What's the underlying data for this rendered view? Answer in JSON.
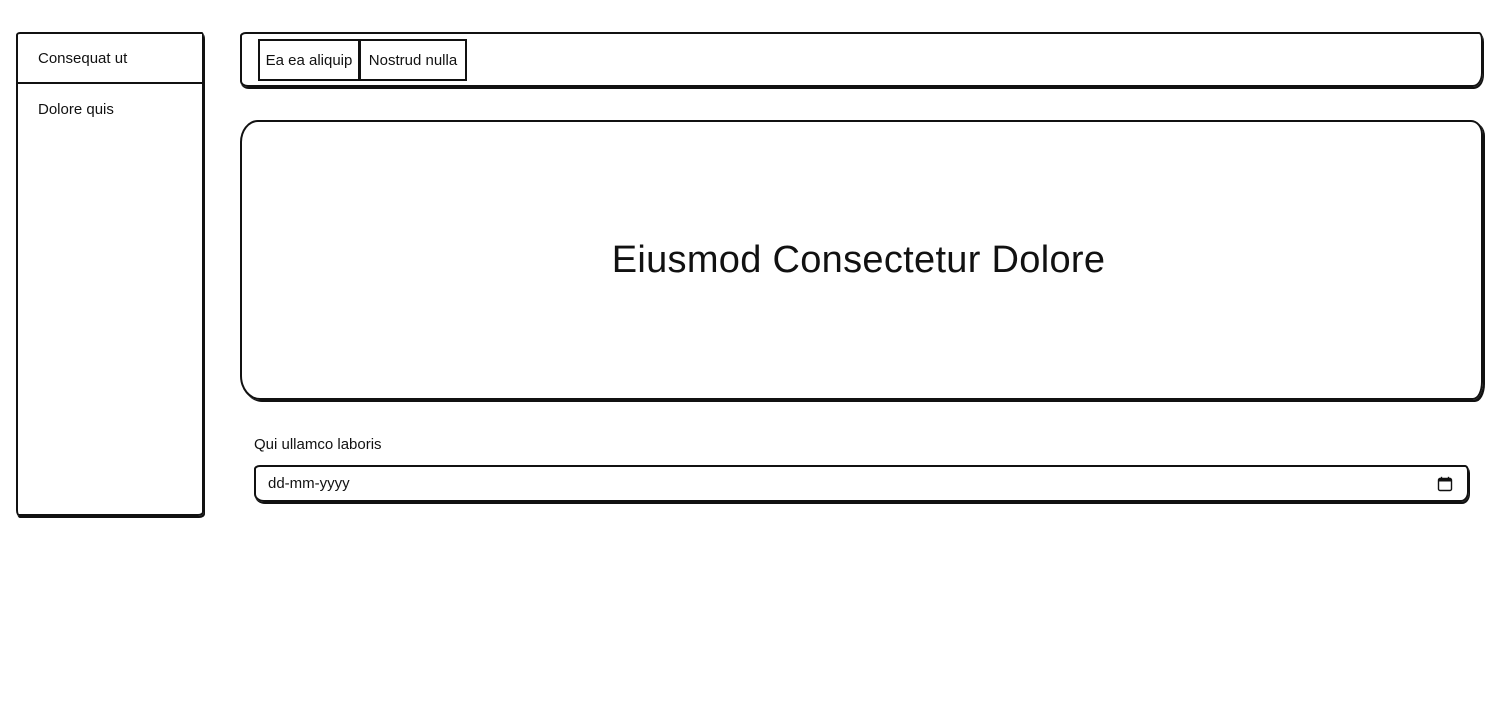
{
  "sidebar": {
    "items": [
      {
        "label": "Consequat ut"
      },
      {
        "label": "Dolore quis"
      }
    ]
  },
  "topbar": {
    "tabs": [
      {
        "label": "Ea ea aliquip"
      },
      {
        "label": "Nostrud nulla"
      }
    ]
  },
  "hero": {
    "title": "Eiusmod Consectetur Dolore"
  },
  "form": {
    "date_label": "Qui ullamco laboris",
    "date_placeholder": "dd-mm-yyyy",
    "date_value": "",
    "calendar_icon": "calendar-icon"
  }
}
